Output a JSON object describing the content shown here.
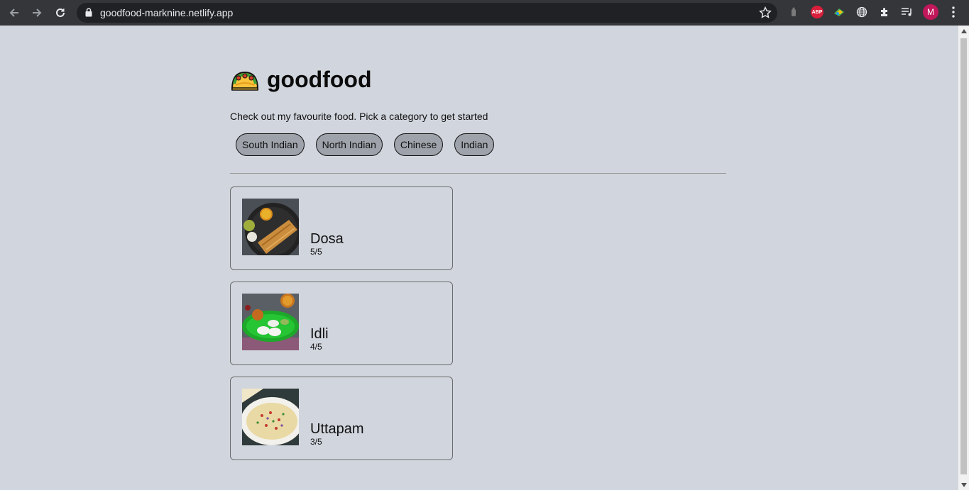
{
  "browser": {
    "url": "goodfood-marknine.netlify.app",
    "avatar_letter": "M",
    "abp_label": "ABP"
  },
  "page": {
    "title": "goodfood",
    "logo_icon": "taco-emoji",
    "subtitle": "Check out my favourite food. Pick a category to get started",
    "categories": [
      {
        "label": "South Indian"
      },
      {
        "label": "North Indian"
      },
      {
        "label": "Chinese"
      },
      {
        "label": "Indian"
      }
    ],
    "foods": [
      {
        "name": "Dosa",
        "rating": "5/5"
      },
      {
        "name": "Idli",
        "rating": "4/5"
      },
      {
        "name": "Uttapam",
        "rating": "3/5"
      }
    ]
  },
  "colors": {
    "page_background": "#d1d5dd",
    "category_button": "#9ea2aa",
    "chrome": "#35363a"
  }
}
